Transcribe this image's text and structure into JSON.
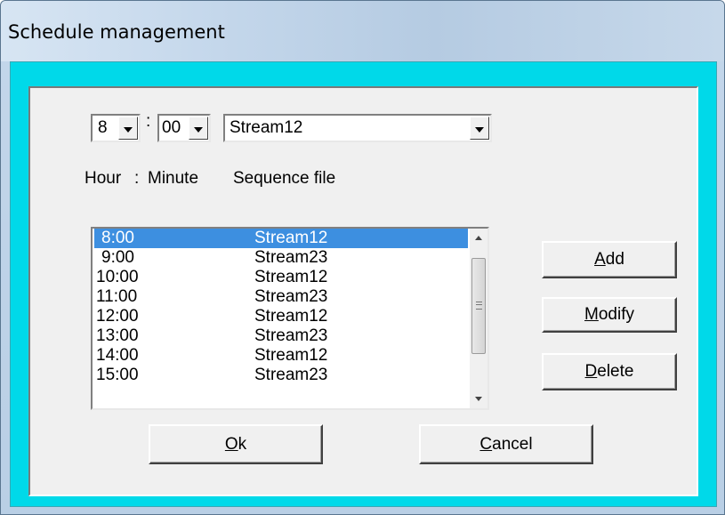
{
  "window": {
    "title": "Schedule management"
  },
  "controls": {
    "hour_value": "8",
    "colon": ":",
    "minute_value": "00",
    "sequence_value": "Stream12",
    "labels": {
      "hour": "Hour",
      "sep": ":",
      "minute": "Minute",
      "sequence": "Sequence file"
    }
  },
  "schedule": [
    {
      "time": "8:00",
      "file": "Stream12"
    },
    {
      "time": "9:00",
      "file": "Stream23"
    },
    {
      "time": "10:00",
      "file": "Stream12"
    },
    {
      "time": "11:00",
      "file": "Stream23"
    },
    {
      "time": "12:00",
      "file": "Stream12"
    },
    {
      "time": "13:00",
      "file": "Stream23"
    },
    {
      "time": "14:00",
      "file": "Stream12"
    },
    {
      "time": "15:00",
      "file": "Stream23"
    }
  ],
  "buttons": {
    "add_key": "A",
    "add_rest": "dd",
    "modify_key": "M",
    "modify_rest": "odify",
    "delete_key": "D",
    "delete_rest": "elete",
    "ok_key": "O",
    "ok_rest": "k",
    "cancel_key": "C",
    "cancel_rest": "ancel"
  },
  "colors": {
    "frame": "#00d9e9",
    "selection": "#3d8fe0",
    "client": "#f0f0f0"
  }
}
